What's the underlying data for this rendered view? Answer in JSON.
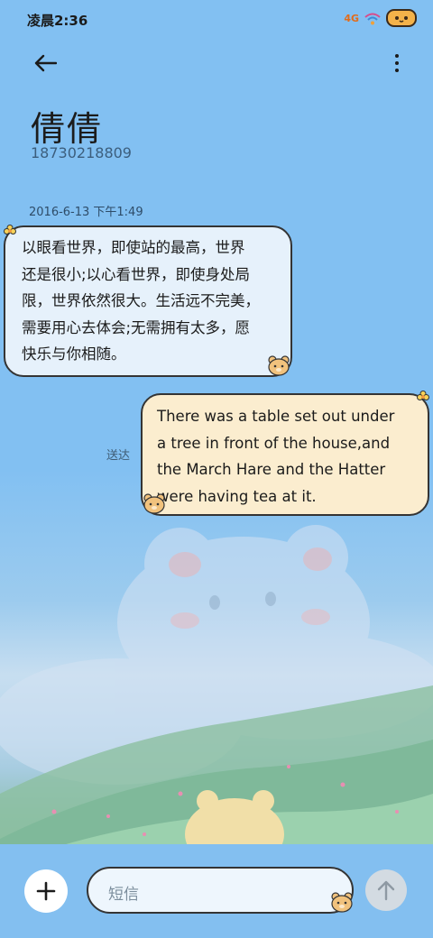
{
  "status_bar": {
    "time": "凌晨2:36",
    "signal_label": "4G"
  },
  "header": {
    "back_icon": "arrow-left-icon",
    "more_icon": "more-vertical-icon"
  },
  "contact": {
    "name": "倩倩",
    "number": "18730218809"
  },
  "conversation": {
    "timestamp": "2016-6-13 下午1:49",
    "messages": [
      {
        "direction": "incoming",
        "lines": [
          "以眼看世界，即使站的最高，世界",
          "还是很小;以心看世界，即使身处局",
          "限，世界依然很大。生活远不完美，",
          "需要用心去体会;无需拥有太多，愿",
          "快乐与你相随。"
        ]
      },
      {
        "direction": "outgoing",
        "lines": [
          "There was a table set out under",
          "a tree in front of the house,and",
          "the March Hare and the Hatter",
          "were having tea at it."
        ],
        "status": "送达"
      }
    ]
  },
  "composer": {
    "placeholder": "短信",
    "add_icon": "plus-icon",
    "send_icon": "arrow-up-icon"
  },
  "colors": {
    "background": "#82c0f2",
    "incoming_bubble": "#e6f1fb",
    "outgoing_bubble": "#fbedcf",
    "bubble_border": "#343434"
  }
}
